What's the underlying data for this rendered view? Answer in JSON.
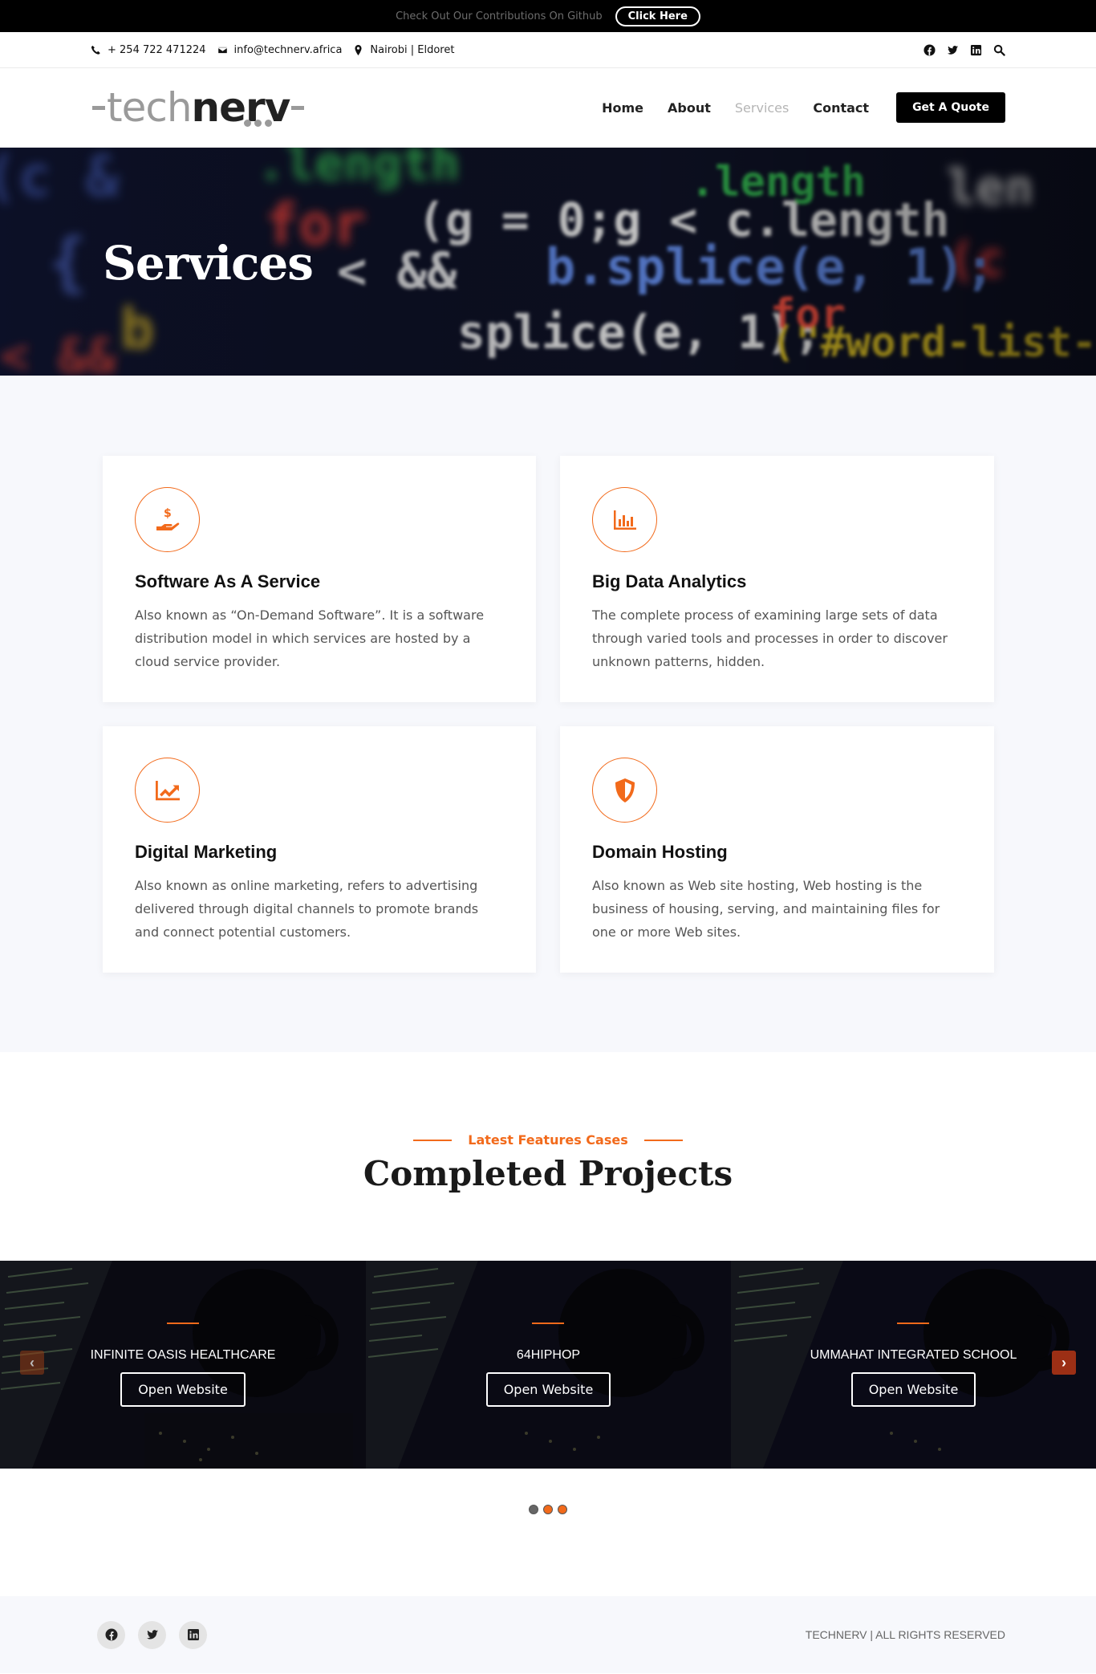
{
  "topbar": {
    "text": "Check Out Our Contributions On Github",
    "button": "Click Here"
  },
  "contact": {
    "phone": "+ 254 722 471224",
    "email": "info@technerv.africa",
    "location": "Nairobi | Eldoret",
    "icons": [
      "phone-icon",
      "envelope-icon",
      "map-pin-icon",
      "facebook-icon",
      "twitter-icon",
      "linkedin-icon",
      "search-icon"
    ]
  },
  "logo": {
    "tech": "tech",
    "nerv": "nerv"
  },
  "nav": {
    "items": [
      "Home",
      "About",
      "Services",
      "Contact"
    ],
    "active": "Services",
    "cta": "Get A Quote"
  },
  "hero": {
    "title": "Services"
  },
  "services": [
    {
      "title": "Software As A Service",
      "desc": "Also known as “On-Demand Software”. It is a software distribution model in which services are hosted by a cloud service provider.",
      "icon": "hand-dollar-icon"
    },
    {
      "title": "Big Data Analytics",
      "desc": "The complete process of examining large sets of data through varied tools and processes in order to discover unknown patterns, hidden.",
      "icon": "bar-chart-icon"
    },
    {
      "title": "Digital Marketing",
      "desc": "Also known as online marketing, refers to advertising delivered through digital channels to promote brands and connect potential customers.",
      "icon": "trend-chart-icon"
    },
    {
      "title": "Domain Hosting",
      "desc": "Also known as Web site hosting, Web hosting is the business of housing, serving, and maintaining files for one or more Web sites.",
      "icon": "shield-icon"
    }
  ],
  "projects": {
    "eyebrow": "Latest Features Cases",
    "title": "Completed Projects",
    "slides": [
      {
        "title": "INFINITE OASIS HEALTHCARE",
        "button": "Open Website"
      },
      {
        "title": "64HIPHOP",
        "button": "Open Website"
      },
      {
        "title": "UMMAHAT INTEGRATED SCHOOL",
        "button": "Open Website"
      }
    ],
    "prev": "‹",
    "next": "›"
  },
  "footer": {
    "copyright": "TECHNERV | ALL RIGHTS RESERVED"
  },
  "colors": {
    "accent": "#f26a1b",
    "dark": "#000000",
    "section_bg": "#f7f8fc"
  }
}
